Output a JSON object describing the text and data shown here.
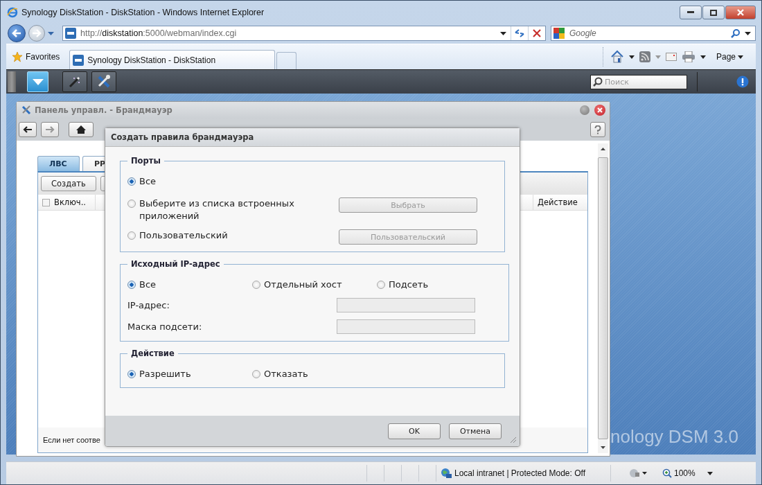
{
  "browser": {
    "title": "Synology DiskStation - DiskStation - Windows Internet Explorer",
    "url_parts": [
      "http://",
      "diskstation",
      ":5000/webman/index.cgi"
    ],
    "search_placeholder": "Google",
    "favorites": "Favorites",
    "tabs": [
      {
        "label": "Synology DiskStation - DiskStation",
        "selected": true
      }
    ],
    "page_menu": "Page"
  },
  "dsm": {
    "search_placeholder": "Поиск",
    "desktop_logo": "nology DSM 3.0"
  },
  "panel": {
    "title": "Панель управл. - Брандмауэр",
    "tabs": [
      {
        "label": "ЛВС",
        "selected": true
      },
      {
        "label": "PP",
        "selected": false
      }
    ],
    "toolbar": [
      "Создать"
    ],
    "select_all": {
      "checked": false
    },
    "columns": [
      "Включ..",
      "Действие"
    ],
    "footer": "Если нет соотве"
  },
  "dialog": {
    "title": "Создать правила брандмауэра",
    "sections": [
      {
        "legend": "Порты",
        "kind": "radio_list",
        "options": [
          {
            "label": "Все",
            "selected": true
          },
          {
            "label": "Выберите из списка встроенных приложений",
            "selected": false,
            "button": {
              "label": "Выбрать",
              "disabled": true
            }
          },
          {
            "label": "Пользовательский",
            "selected": false,
            "button": {
              "label": "Пользовательский",
              "disabled": true
            }
          }
        ]
      },
      {
        "legend": "Исходный IP-адрес",
        "kind": "radio_row",
        "options": [
          {
            "label": "Все",
            "selected": true
          },
          {
            "label": "Отдельный хост",
            "selected": false
          },
          {
            "label": "Подсеть",
            "selected": false
          }
        ],
        "fields": [
          {
            "label": "IP-адрес:",
            "disabled": true
          },
          {
            "label": "Маска подсети:",
            "disabled": true
          }
        ]
      },
      {
        "legend": "Действие",
        "kind": "radio_row",
        "options": [
          {
            "label": "Разрешить",
            "selected": true
          },
          {
            "label": "Отказать",
            "selected": false
          }
        ]
      }
    ],
    "buttons": [
      "OK",
      "Отмена"
    ]
  },
  "status_bar": {
    "zone": "Local intranet | Protected Mode: Off",
    "zoom": "100%"
  }
}
